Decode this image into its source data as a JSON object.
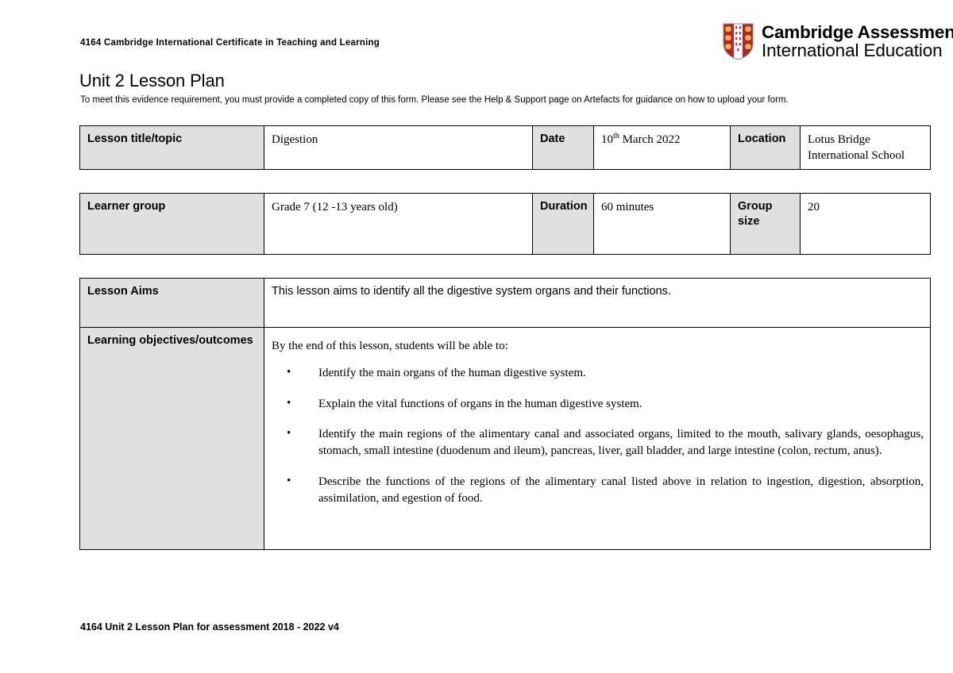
{
  "header": {
    "course_code_title": "4164 Cambridge International Certificate in Teaching and Learning",
    "logo": {
      "name": "cambridge-assessment-logo",
      "line1": "Cambridge Assessment",
      "line2": "International Education",
      "shield_field_color": "#B7232B",
      "shield_band_color": "#FFFFFF",
      "shield_charge_color": "#E8B93A"
    }
  },
  "document": {
    "title": "Unit 2 Lesson Plan",
    "subtitle": "To meet this evidence requirement, you must provide a completed copy of this form. Please see the Help & Support page on Artefacts for guidance on how to upload your form."
  },
  "lesson_info": {
    "label_title": "Lesson title/topic",
    "value_title": "Digestion",
    "label_date": "Date",
    "value_date_day": "10",
    "value_date_ordinal": "th",
    "value_date_rest": " March 2022",
    "label_location": "Location",
    "value_location": "Lotus Bridge International School"
  },
  "learner_info": {
    "label_learner_group": "Learner group",
    "value_learner_group": "Grade 7 (12 -13 years old)",
    "label_duration": "Duration",
    "value_duration": "60 minutes",
    "label_group_size": "Group size",
    "value_group_size": "20"
  },
  "aims": {
    "label": "Lesson Aims",
    "value": "This lesson aims to identify all the digestive system organs and their functions."
  },
  "objectives": {
    "label": "Learning objectives/outcomes",
    "intro": "By the end of this lesson, students will be able to:",
    "items": [
      "Identify the main organs of the human digestive system.",
      "Explain the vital functions of organs in the human digestive system.",
      "Identify the main regions of the alimentary canal and associated organs, limited to the mouth, salivary glands, oesophagus, stomach, small intestine (duodenum and ileum), pancreas, liver, gall bladder, and large intestine (colon, rectum, anus).",
      "Describe the functions of the regions of the alimentary canal listed above in relation to ingestion, digestion, absorption, assimilation, and egestion of food."
    ]
  },
  "footer": {
    "text": "4164 Unit 2 Lesson Plan for assessment 2018 - 2022 v4"
  },
  "theme": {
    "label_cell_background": "#E0E0E0",
    "border_color": "#000000",
    "page_background": "#FFFFFF"
  }
}
